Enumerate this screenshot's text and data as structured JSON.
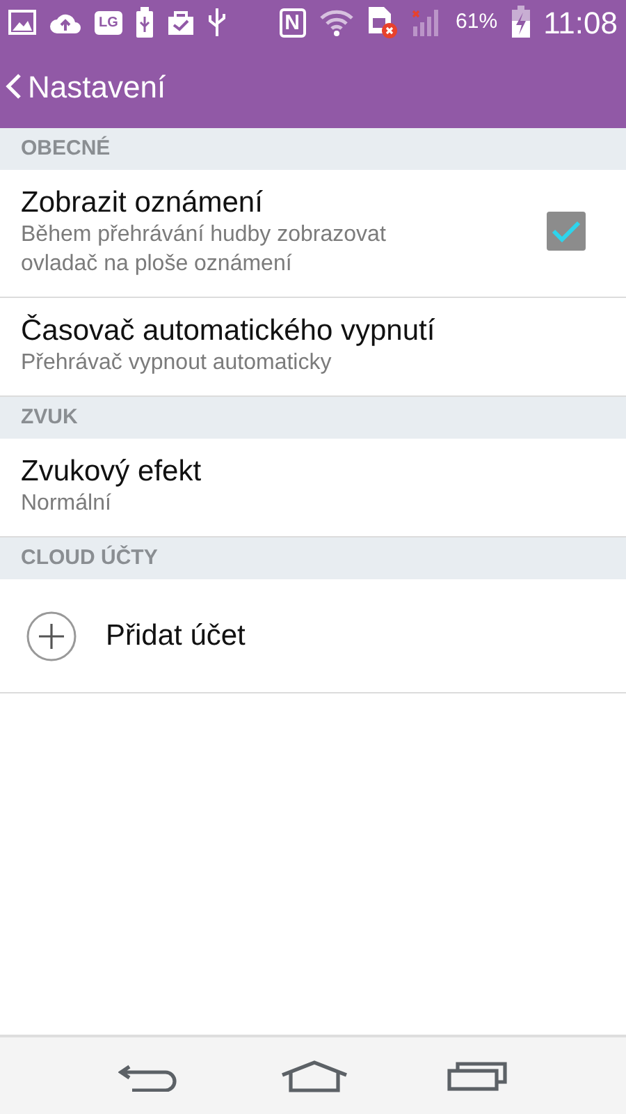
{
  "status_bar": {
    "lg_label": "LG",
    "nfc_label": "N",
    "battery": "61%",
    "time": "11:08"
  },
  "app_bar": {
    "title": "Nastavení"
  },
  "sections": [
    {
      "title": "OBECNÉ",
      "items": [
        {
          "kind": "checkbox",
          "title": "Zobrazit oznámení",
          "summary": "Během přehrávání hudby zobrazovat ovladač na ploše oznámení",
          "checked": true
        },
        {
          "kind": "text",
          "title": "Časovač automatického vypnutí",
          "summary": "Přehrávač vypnout automaticky"
        }
      ]
    },
    {
      "title": "ZVUK",
      "items": [
        {
          "kind": "text",
          "title": "Zvukový efekt",
          "summary": "Normální"
        }
      ]
    },
    {
      "title": "CLOUD ÚČTY",
      "items": [
        {
          "kind": "add",
          "title": "Přidat účet"
        }
      ]
    }
  ]
}
